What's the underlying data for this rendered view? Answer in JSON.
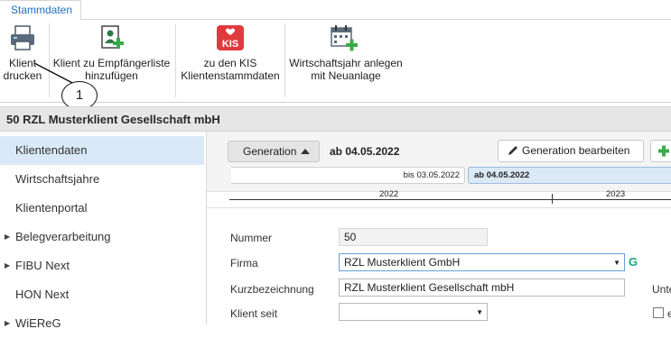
{
  "ribbon_tab": "Stammdaten",
  "ribbon": {
    "buttons": [
      {
        "label_line1": "Klient",
        "label_line2": "drucken",
        "icon": "printer-icon"
      },
      {
        "label_line1": "Klient zu Empfängerliste",
        "label_line2": "hinzufügen",
        "icon": "add-recipient-icon"
      },
      {
        "label_line1": "zu den KIS",
        "label_line2": "Klientenstammdaten",
        "icon": "kis-icon",
        "icon_text": "KIS"
      },
      {
        "label_line1": "Wirtschaftsjahr anlegen",
        "label_line2": "mit Neuanlage",
        "icon": "calendar-add-icon"
      }
    ]
  },
  "callout": "1",
  "title": "50 RZL Musterklient Gesellschaft mbH",
  "sidebar": {
    "items": [
      {
        "label": "Klientendaten",
        "active": true,
        "expandable": false
      },
      {
        "label": "Wirtschaftsjahre",
        "active": false,
        "expandable": false
      },
      {
        "label": "Klientenportal",
        "active": false,
        "expandable": false
      },
      {
        "label": "Belegverarbeitung",
        "active": false,
        "expandable": true
      },
      {
        "label": "FIBU Next",
        "active": false,
        "expandable": true
      },
      {
        "label": "HON Next",
        "active": false,
        "expandable": false
      },
      {
        "label": "WiEReG",
        "active": false,
        "expandable": true
      }
    ]
  },
  "generation": {
    "button_label": "Generation",
    "current": "ab 04.05.2022",
    "edit_label": "Generation bearbeiten",
    "timeline": {
      "segments": [
        "bis 03.05.2022",
        "ab 04.05.2022"
      ],
      "years": [
        "2022",
        "2023"
      ]
    }
  },
  "form": {
    "nummer_label": "Nummer",
    "nummer_value": "50",
    "firma_label": "Firma",
    "firma_value": "RZL Musterklient GmbH",
    "firma_badge": "G",
    "kurz_label": "Kurzbezeichnung",
    "kurz_value": "RZL Musterklient Gesellschaft mbH",
    "klient_seit_label": "Klient seit",
    "klient_seit_value": "",
    "right_label": "Unte",
    "right_check_label": "e"
  },
  "colors": {
    "accent": "#1e6fbf",
    "selection": "#d9e9f7",
    "kis_red": "#e03a3e",
    "green": "#3bab49",
    "badge_g": "#17a589"
  }
}
